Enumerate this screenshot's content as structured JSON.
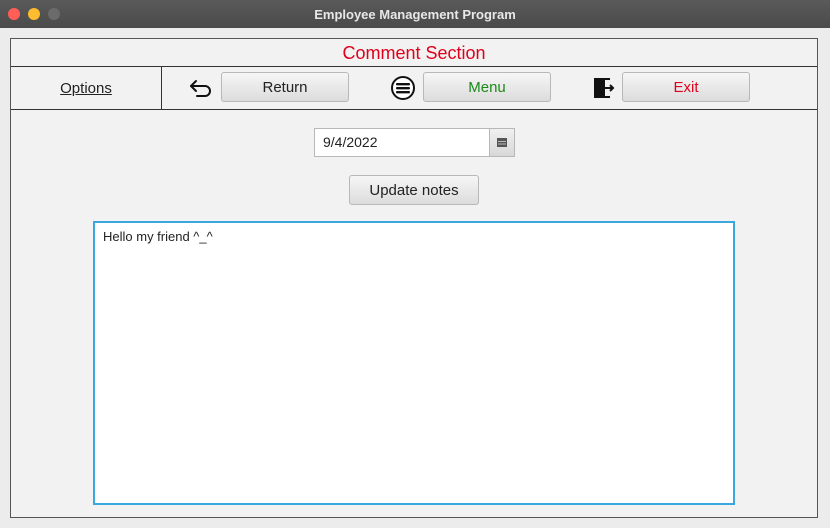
{
  "window": {
    "title": "Employee Management Program"
  },
  "header": {
    "section_title": "Comment Section"
  },
  "toolbar": {
    "options_label": "Options",
    "return_label": "Return",
    "menu_label": "Menu",
    "exit_label": "Exit",
    "icons": {
      "return": "undo-arrow-icon",
      "menu": "list-menu-icon",
      "exit": "door-exit-icon"
    }
  },
  "form": {
    "date_value": "9/4/2022",
    "update_label": "Update notes",
    "notes_text": "Hello my friend ^_^"
  },
  "colors": {
    "title_red": "#e0001b",
    "menu_green": "#1a8a1a",
    "focus_blue": "#3aa7e0"
  }
}
